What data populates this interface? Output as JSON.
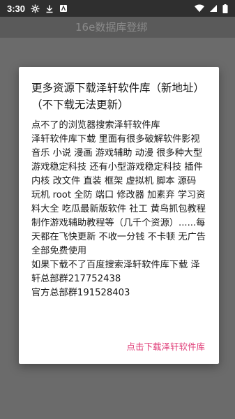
{
  "status_bar": {
    "time": "3:30",
    "icons": [
      "settings-icon",
      "download-icon",
      "app-icon",
      "wifi-icon",
      "signal-icon",
      "battery-icon"
    ]
  },
  "app_bar": {
    "title": "16e数据库登绑"
  },
  "dialog": {
    "title": "更多资源下载泽轩软件库（新地址）（不下载无法更新）",
    "message": "点不了的浏览器搜索泽轩软件库\n泽轩软件库下载 里面有很多破解软件影视 音乐 小说 漫画 游戏辅助 动漫 很多种大型游戏稳定科技 还有小型游戏稳定科技 插件 内核 改文件 直装 框架 虚拟机 脚本 源码 玩机 root 全防 端口 修改器 加素弃 学习资料大全 吃瓜最新版软件 社工 黄鸟抓包教程 制作游戏辅助教程等（几千个资源）......每天都在飞快更新 不收一分钱 不卡顿 无广告 全部免费使用\n如果下载不了百度搜索泽轩软件库下载 泽轩总部群217752438\n官方总部群191528403",
    "action_label": "点击下载泽轩软件库"
  },
  "colors": {
    "status_bar": "#2f2f2f",
    "scrim": "#6b6b6b",
    "accent": "#e0407a"
  }
}
